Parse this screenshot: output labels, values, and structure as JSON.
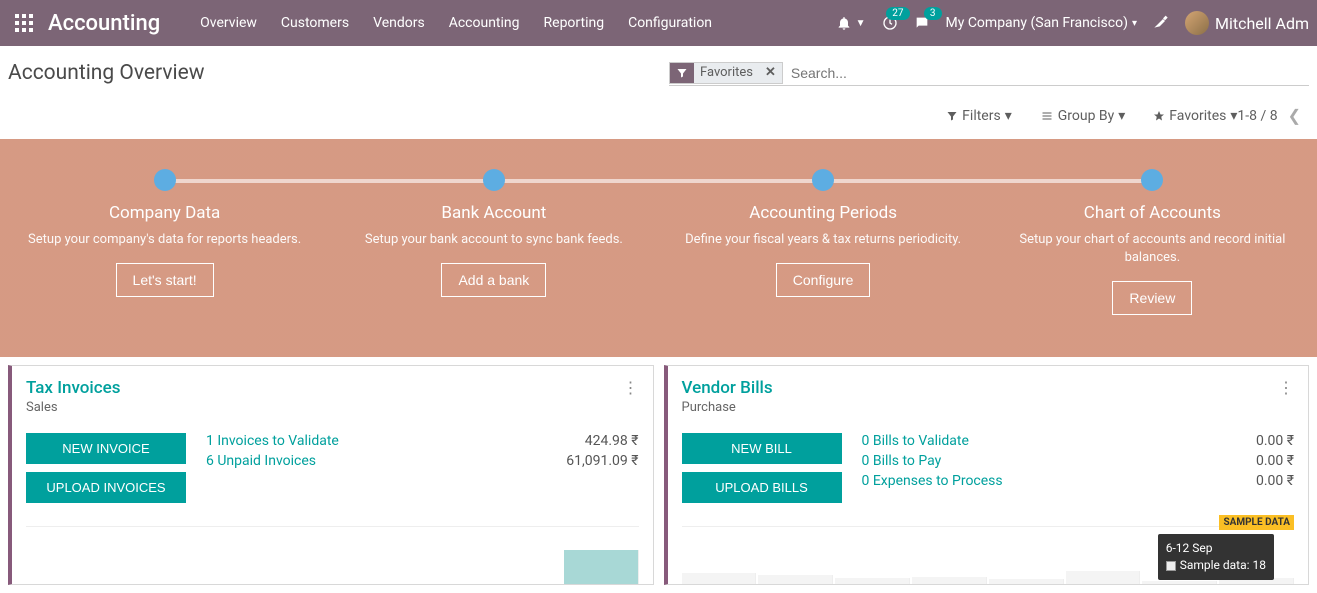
{
  "brand": "Accounting",
  "nav": [
    "Overview",
    "Customers",
    "Vendors",
    "Accounting",
    "Reporting",
    "Configuration"
  ],
  "activity_badge": "27",
  "chat_badge": "3",
  "company": "My Company (San Francisco)",
  "user_name": "Mitchell Adm",
  "page_title": "Accounting Overview",
  "search_facet": "Favorites",
  "search_placeholder": "Search...",
  "controls": {
    "filters": "Filters",
    "group_by": "Group By",
    "favorites": "Favorites"
  },
  "pager": "1-8 / 8",
  "banner": {
    "steps": [
      {
        "title": "Company Data",
        "desc": "Setup your company's data for reports headers.",
        "btn": "Let's start!"
      },
      {
        "title": "Bank Account",
        "desc": "Setup your bank account to sync bank feeds.",
        "btn": "Add a bank"
      },
      {
        "title": "Accounting Periods",
        "desc": "Define your fiscal years & tax returns periodicity.",
        "btn": "Configure"
      },
      {
        "title": "Chart of Accounts",
        "desc": "Setup your chart of accounts and record initial balances.",
        "btn": "Review"
      }
    ]
  },
  "cards": {
    "tax": {
      "title": "Tax Invoices",
      "sub": "Sales",
      "btn1": "NEW INVOICE",
      "btn2": "UPLOAD INVOICES",
      "stats": [
        {
          "label": "1 Invoices to Validate",
          "amt": "424.98 ₹"
        },
        {
          "label": "6 Unpaid Invoices",
          "amt": "61,091.09 ₹"
        }
      ]
    },
    "vendor": {
      "title": "Vendor Bills",
      "sub": "Purchase",
      "btn1": "NEW BILL",
      "btn2": "UPLOAD BILLS",
      "stats": [
        {
          "label": "0 Bills to Validate",
          "amt": "0.00 ₹"
        },
        {
          "label": "0 Bills to Pay",
          "amt": "0.00 ₹"
        },
        {
          "label": "0 Expenses to Process",
          "amt": "0.00 ₹"
        }
      ],
      "sample": "SAMPLE DATA",
      "tooltip_date": "6-12 Sep",
      "tooltip_label": "Sample data: 18"
    }
  }
}
